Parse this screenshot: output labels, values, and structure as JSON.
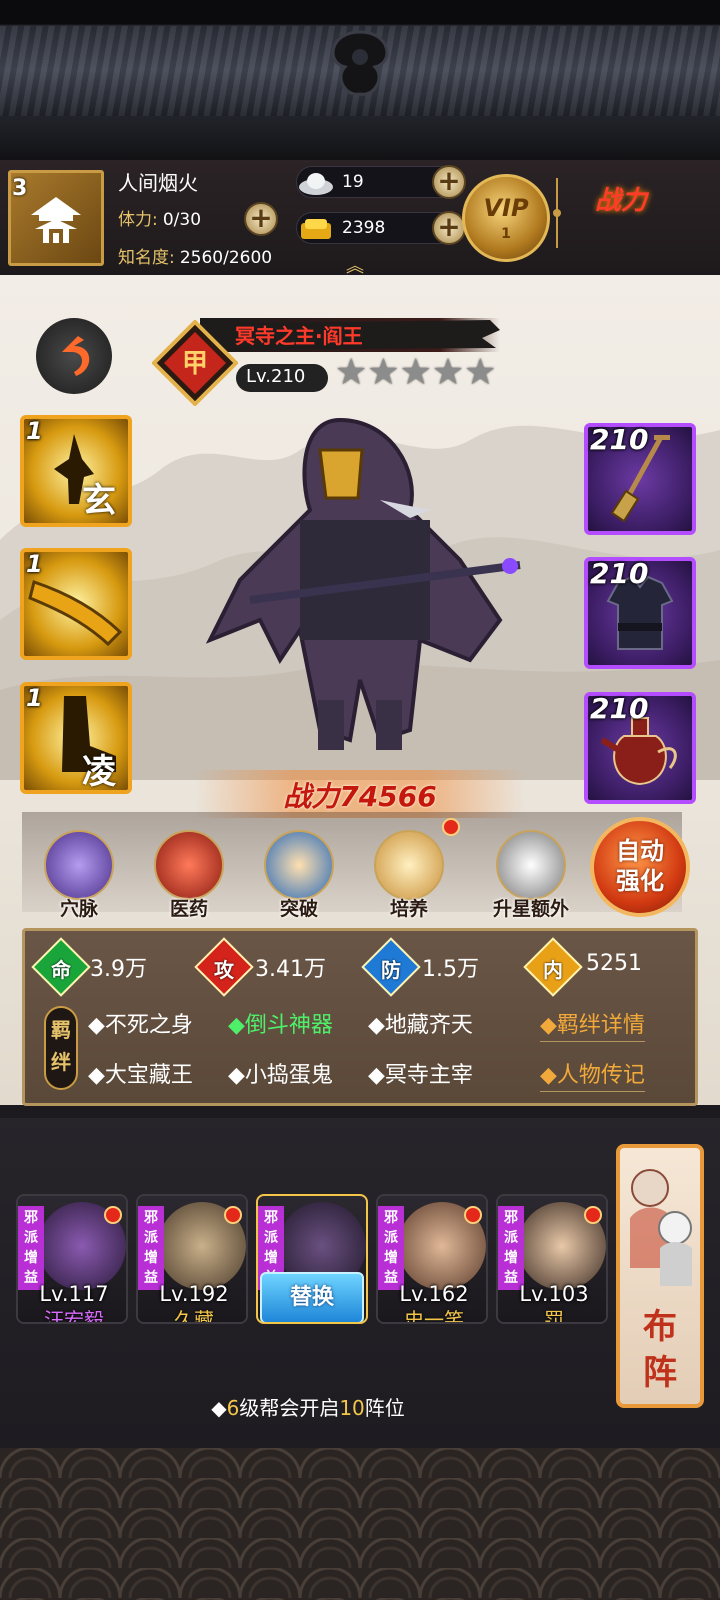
{
  "header": {
    "avatar_level": "3",
    "player_name": "人间烟火",
    "stamina_label": "体力:",
    "stamina_value": "0/30",
    "fame_label": "知名度:",
    "fame_value": "2560/2600",
    "silver": "19",
    "gold": "2398",
    "vip_label": "VIP",
    "vip_level": "1",
    "power_logo": "战力"
  },
  "hero": {
    "title": "冥寺之主·阎王",
    "level": "Lv.210",
    "stars": [
      "★",
      "★",
      "★",
      "★",
      "★"
    ],
    "power_label": "战力",
    "power_value": "74566",
    "skills": [
      {
        "num": "1",
        "glyph": "玄"
      },
      {
        "num": "1",
        "glyph": ""
      },
      {
        "num": "1",
        "glyph": "凌"
      }
    ],
    "equipment": [
      {
        "num": "210",
        "icon": "shovel-icon"
      },
      {
        "num": "210",
        "icon": "armor-icon"
      },
      {
        "num": "210",
        "icon": "teapot-icon"
      }
    ]
  },
  "functions": [
    {
      "label": "穴脉",
      "icon": "meridian-icon",
      "badge": false
    },
    {
      "label": "医药",
      "icon": "herb-icon",
      "badge": false
    },
    {
      "label": "突破",
      "icon": "breakthrough-icon",
      "badge": false
    },
    {
      "label": "培养",
      "icon": "scroll-icon",
      "badge": true
    },
    {
      "label": "升星额外",
      "icon": "gauntlet-icon",
      "badge": false
    }
  ],
  "auto_button": {
    "line1": "自动",
    "line2": "强化"
  },
  "stats": [
    {
      "char": "命",
      "value": "3.9万",
      "color": "#1aa53a"
    },
    {
      "char": "攻",
      "value": "3.41万",
      "color": "#d3231b"
    },
    {
      "char": "防",
      "value": "1.5万",
      "color": "#1f7ad6"
    },
    {
      "char": "内",
      "value": "5251",
      "color": "#e8a016"
    }
  ],
  "bonds": {
    "tag": "羁绊",
    "row1": [
      {
        "text": "◆不死之身",
        "active": false
      },
      {
        "text": "◆倒斗神器",
        "active": true
      },
      {
        "text": "◆地藏齐天",
        "active": false
      }
    ],
    "row2": [
      {
        "text": "◆大宝藏王",
        "active": false
      },
      {
        "text": "◆小捣蛋鬼",
        "active": false
      },
      {
        "text": "◆冥寺主宰",
        "active": false
      }
    ],
    "detail_link": "◆羁绊详情",
    "bio_link": "◆人物传记"
  },
  "lineup": [
    {
      "faction": "邪派增益",
      "level": "Lv.117",
      "name": "汪宏毅",
      "name_color": "#d96bff",
      "badge": true
    },
    {
      "faction": "邪派增益",
      "level": "Lv.192",
      "name": "久藏",
      "name_color": "#f3c64a",
      "badge": true
    },
    {
      "faction": "邪派增益",
      "level": "",
      "name": "",
      "name_color": "#ffffff",
      "badge": false,
      "replace": "替换"
    },
    {
      "faction": "邪派增益",
      "level": "Lv.162",
      "name": "史一笑",
      "name_color": "#f3c64a",
      "badge": true
    },
    {
      "faction": "邪派增益",
      "level": "Lv.103",
      "name": "罚",
      "name_color": "#f3c64a",
      "badge": true
    }
  ],
  "formation_button": {
    "line1": "布",
    "line2": "阵"
  },
  "guild_tip": {
    "prefix": "◆",
    "a": "6",
    "mid": "级帮会开启",
    "b": "10",
    "suffix": "阵位"
  }
}
